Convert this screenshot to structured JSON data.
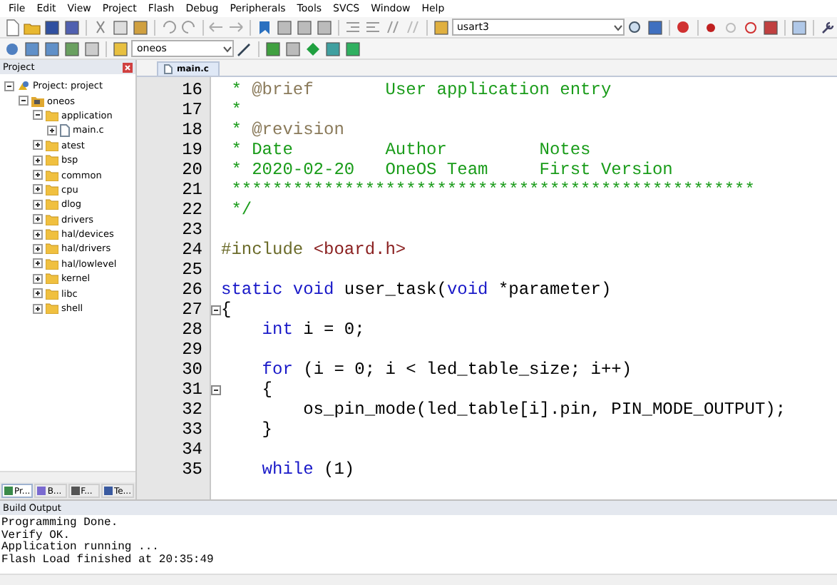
{
  "menu": [
    "File",
    "Edit",
    "View",
    "Project",
    "Flash",
    "Debug",
    "Peripherals",
    "Tools",
    "SVCS",
    "Window",
    "Help"
  ],
  "toolbar": {
    "search_combo": "usart3",
    "target_combo": "oneos"
  },
  "project_panel": {
    "title": "Project",
    "tree": [
      {
        "label": "Project: project",
        "kind": "project",
        "expanded": true,
        "children": [
          {
            "label": "oneos",
            "kind": "target",
            "expanded": true,
            "children": [
              {
                "label": "application",
                "kind": "folder",
                "expanded": true,
                "children": [
                  {
                    "label": "main.c",
                    "kind": "file",
                    "expanded": false
                  }
                ]
              },
              {
                "label": "atest",
                "kind": "folder",
                "expanded": false
              },
              {
                "label": "bsp",
                "kind": "folder",
                "expanded": false
              },
              {
                "label": "common",
                "kind": "folder",
                "expanded": false
              },
              {
                "label": "cpu",
                "kind": "folder",
                "expanded": false
              },
              {
                "label": "dlog",
                "kind": "folder",
                "expanded": false
              },
              {
                "label": "drivers",
                "kind": "folder",
                "expanded": false
              },
              {
                "label": "hal/devices",
                "kind": "folder",
                "expanded": false
              },
              {
                "label": "hal/drivers",
                "kind": "folder",
                "expanded": false
              },
              {
                "label": "hal/lowlevel",
                "kind": "folder",
                "expanded": false
              },
              {
                "label": "kernel",
                "kind": "folder",
                "expanded": false
              },
              {
                "label": "libc",
                "kind": "folder",
                "expanded": false
              },
              {
                "label": "shell",
                "kind": "folder",
                "expanded": false
              }
            ]
          }
        ]
      }
    ],
    "tabs": [
      {
        "label": "Pr...",
        "selected": true
      },
      {
        "label": "B...",
        "selected": false
      },
      {
        "label": "F...",
        "selected": false
      },
      {
        "label": "Te...",
        "selected": false
      }
    ]
  },
  "editor": {
    "tabs": [
      {
        "label": "main.c",
        "selected": true
      }
    ],
    "lines": [
      {
        "number": "16",
        "segments": [
          {
            "kind": "comment",
            "text": " * "
          },
          {
            "kind": "doctag",
            "text": "@brief"
          },
          {
            "kind": "comment",
            "text": "       User application entry"
          }
        ]
      },
      {
        "number": "17",
        "segments": [
          {
            "kind": "comment",
            "text": " *"
          }
        ]
      },
      {
        "number": "18",
        "segments": [
          {
            "kind": "comment",
            "text": " * "
          },
          {
            "kind": "doctag",
            "text": "@revision"
          }
        ]
      },
      {
        "number": "19",
        "segments": [
          {
            "kind": "comment",
            "text": " * Date         Author         Notes"
          }
        ]
      },
      {
        "number": "20",
        "segments": [
          {
            "kind": "comment",
            "text": " * 2020-02-20   OneOS Team     First Version"
          }
        ]
      },
      {
        "number": "21",
        "segments": [
          {
            "kind": "comment",
            "text": " ***************************************************"
          }
        ]
      },
      {
        "number": "22",
        "segments": [
          {
            "kind": "comment",
            "text": " */"
          }
        ]
      },
      {
        "number": "23"
      },
      {
        "number": "24",
        "segments": [
          {
            "kind": "preproc",
            "text": "#include "
          },
          {
            "kind": "header",
            "text": "<board.h>"
          }
        ]
      },
      {
        "number": "25"
      },
      {
        "number": "26",
        "segments": [
          {
            "kind": "keyword",
            "text": "static void"
          },
          {
            "kind": "plain",
            "text": " user_task("
          },
          {
            "kind": "keyword",
            "text": "void"
          },
          {
            "kind": "plain",
            "text": " *parameter)"
          }
        ]
      },
      {
        "number": "27",
        "fold": true,
        "segments": [
          {
            "kind": "plain",
            "text": "{"
          }
        ]
      },
      {
        "number": "28",
        "segments": [
          {
            "kind": "keyword",
            "text": "    int"
          },
          {
            "kind": "plain",
            "text": " i = 0;"
          }
        ]
      },
      {
        "number": "29"
      },
      {
        "number": "30",
        "segments": [
          {
            "kind": "keyword",
            "text": "    for"
          },
          {
            "kind": "plain",
            "text": " (i = 0; i < led_table_size; i++)"
          }
        ]
      },
      {
        "number": "31",
        "fold": true,
        "segments": [
          {
            "kind": "plain",
            "text": "    {"
          }
        ]
      },
      {
        "number": "32",
        "segments": [
          {
            "kind": "plain",
            "text": "        os_pin_mode(led_table[i].pin, PIN_MODE_OUTPUT);"
          }
        ]
      },
      {
        "number": "33",
        "segments": [
          {
            "kind": "plain",
            "text": "    }"
          }
        ]
      },
      {
        "number": "34"
      },
      {
        "number": "35",
        "segments": [
          {
            "kind": "keyword",
            "text": "    while"
          },
          {
            "kind": "plain",
            "text": " (1)"
          }
        ]
      }
    ]
  },
  "build_output": {
    "title": "Build Output",
    "lines": [
      "Programming Done.",
      "Verify OK.",
      "Application running ...",
      "Flash Load finished at 20:35:49"
    ]
  }
}
